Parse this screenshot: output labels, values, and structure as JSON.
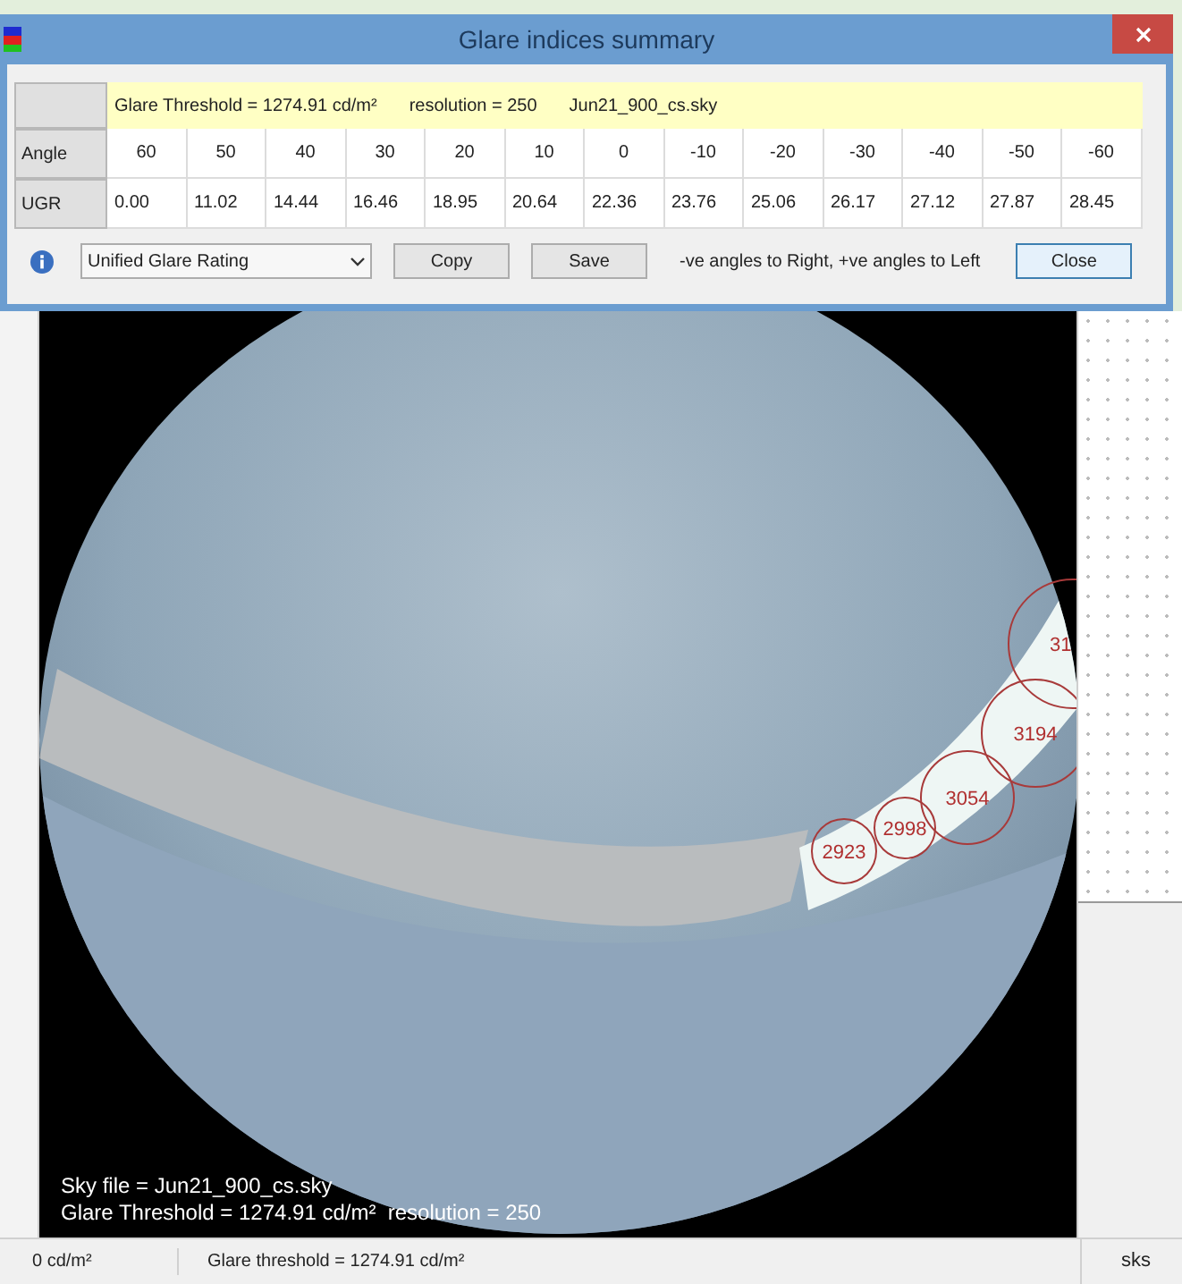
{
  "dialog": {
    "title": "Glare indices summary",
    "header": {
      "threshold": "Glare Threshold = 1274.91 cd/m²",
      "resolution": "resolution = 250",
      "sky": "Jun21_900_cs.sky"
    },
    "rows": [
      {
        "label": "Angle",
        "values": [
          "60",
          "50",
          "40",
          "30",
          "20",
          "10",
          "0",
          "-10",
          "-20",
          "-30",
          "-40",
          "-50",
          "-60"
        ]
      },
      {
        "label": "UGR",
        "values": [
          "0.00",
          "11.02",
          "14.44",
          "16.46",
          "18.95",
          "20.64",
          "22.36",
          "23.76",
          "25.06",
          "26.17",
          "27.12",
          "27.87",
          "28.45"
        ]
      }
    ],
    "metric": "Unified Glare Rating",
    "buttons": [
      "Copy",
      "Save"
    ],
    "note": "-ve angles to Right, +ve angles to Left",
    "close": "Close"
  },
  "render": {
    "sky_file": "Sky file = Jun21_900_cs.sky",
    "threshold_line": "Glare Threshold = 1274.91 cd/m²  resolution = 250",
    "glare_sources": [
      {
        "label": "2923"
      },
      {
        "label": "2998"
      },
      {
        "label": "3054"
      },
      {
        "label": "3194"
      },
      {
        "label": "31"
      }
    ]
  },
  "status_bar": [
    "0 cd/m²",
    "Glare threshold = 1274.91 cd/m²"
  ],
  "right_panel": {
    "tab": "sks"
  }
}
